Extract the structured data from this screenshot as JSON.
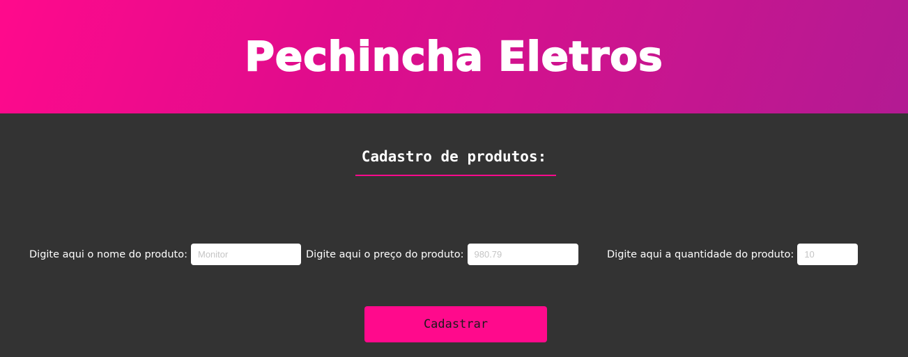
{
  "header": {
    "brand": "Pechincha Eletros"
  },
  "main": {
    "section_title": "Cadastro de produtos:",
    "fields": [
      {
        "label": "Digite aqui o nome do produto:",
        "placeholder": "Monitor",
        "value": ""
      },
      {
        "label": "Digite aqui o preço do produto:",
        "placeholder": "980.79",
        "value": ""
      },
      {
        "label": "Digite aqui a quantidade do produto:",
        "placeholder": "10",
        "value": ""
      }
    ],
    "submit_label": "Cadastrar"
  },
  "colors": {
    "accent": "#ff0a8c",
    "header_gradient_start": "#ff0a8c",
    "header_gradient_end": "#b31a93",
    "background": "#333333",
    "text": "#ffffff"
  }
}
